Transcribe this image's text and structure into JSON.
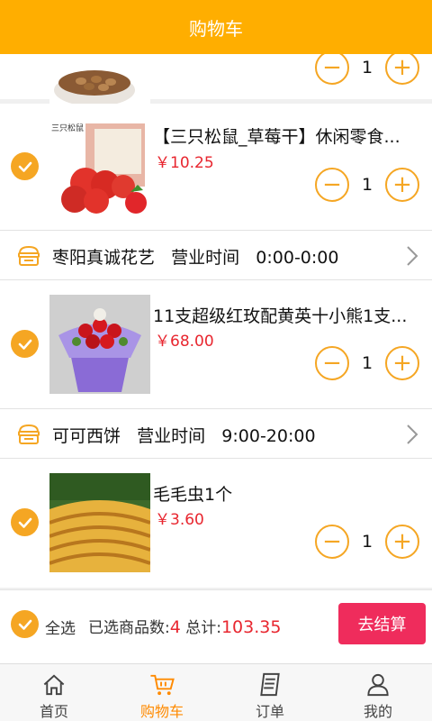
{
  "header": {
    "title": "购物车"
  },
  "colors": {
    "accent": "#ffae00",
    "check": "#f5a623",
    "price": "#e8262f",
    "checkout": "#ef2c5c",
    "tab_active": "#ff8a00"
  },
  "cart": {
    "partial_item": {
      "qty": "1"
    },
    "shops": [
      {
        "items": [
          {
            "name": "【三只松鼠_草莓干】休闲零食...",
            "price": "￥10.25",
            "qty": "1"
          }
        ]
      },
      {
        "shop_name": "枣阳真诚花艺",
        "hours_label": "营业时间",
        "hours": "0:00-0:00",
        "items": [
          {
            "name": "11支超级红玫配黄英十小熊1支...",
            "price": "￥68.00",
            "qty": "1"
          }
        ]
      },
      {
        "shop_name": "可可西饼",
        "hours_label": "营业时间",
        "hours": "9:00-20:00",
        "items": [
          {
            "name": "毛毛虫1个",
            "price": "￥3.60",
            "qty": "1"
          }
        ]
      }
    ]
  },
  "summary": {
    "select_all": "全选",
    "selected_label": "已选商品数:",
    "selected_count": "4",
    "total_label": " 总计:",
    "total": "103.35",
    "checkout": "去结算"
  },
  "tabs": [
    {
      "label": "首页",
      "icon": "home-icon"
    },
    {
      "label": "购物车",
      "icon": "cart-icon"
    },
    {
      "label": "订单",
      "icon": "order-icon"
    },
    {
      "label": "我的",
      "icon": "user-icon"
    }
  ]
}
